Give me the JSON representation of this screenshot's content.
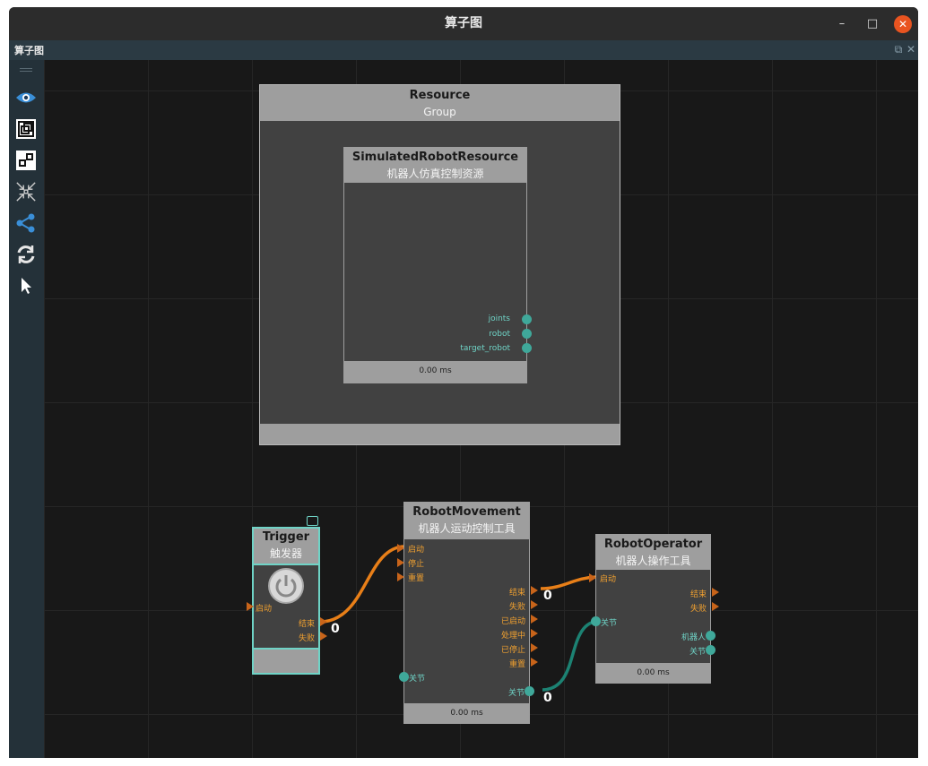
{
  "window": {
    "title": "算子图",
    "minimize": "–",
    "maximize": "□",
    "close": "✕"
  },
  "panel": {
    "title": "算子图",
    "float": "⧉",
    "close": "✕"
  },
  "toolbar": {
    "items": [
      "eye-icon",
      "fit-view-icon",
      "group-icon",
      "collapse-icon",
      "graph-icon",
      "refresh-icon",
      "pointer-icon"
    ]
  },
  "nodes": {
    "resource_group": {
      "name": "Resource",
      "subtitle": "Group"
    },
    "simulated_robot_resource": {
      "name": "SimulatedRobotResource",
      "subtitle": "机器人仿真控制资源",
      "outputs": [
        "joints",
        "robot",
        "target_robot"
      ],
      "time": "0.00 ms"
    },
    "trigger": {
      "name": "Trigger",
      "subtitle": "触发器",
      "inputs": [
        "启动"
      ],
      "outputs": [
        "结束",
        "失败"
      ]
    },
    "robot_movement": {
      "name": "RobotMovement",
      "subtitle": "机器人运动控制工具",
      "inputs": [
        "启动",
        "停止",
        "重置"
      ],
      "outputs": [
        "结束",
        "失败",
        "已启动",
        "处理中",
        "已停止",
        "重置"
      ],
      "data_input": "关节",
      "data_output": "关节",
      "time": "0.00 ms"
    },
    "robot_operator": {
      "name": "RobotOperator",
      "subtitle": "机器人操作工具",
      "inputs": [
        "启动"
      ],
      "data_input": "关节",
      "outputs": [
        "结束",
        "失败"
      ],
      "data_outputs": [
        "机器人",
        "关节"
      ],
      "time": "0.00 ms"
    }
  },
  "connections": [
    {
      "from": "Trigger.结束",
      "to": "RobotMovement.启动",
      "count": "0"
    },
    {
      "from": "RobotMovement.结束",
      "to": "RobotOperator.启动",
      "count": "0"
    },
    {
      "from": "RobotMovement.关节",
      "to": "RobotOperator.关节",
      "count": "0"
    }
  ],
  "colors": {
    "flow_edge": "#e87f18",
    "data_edge": "#1c8273",
    "trigger_border": "#6fd3c6",
    "port_dot": "#3fa89a",
    "flow_port": "#c8641a"
  }
}
